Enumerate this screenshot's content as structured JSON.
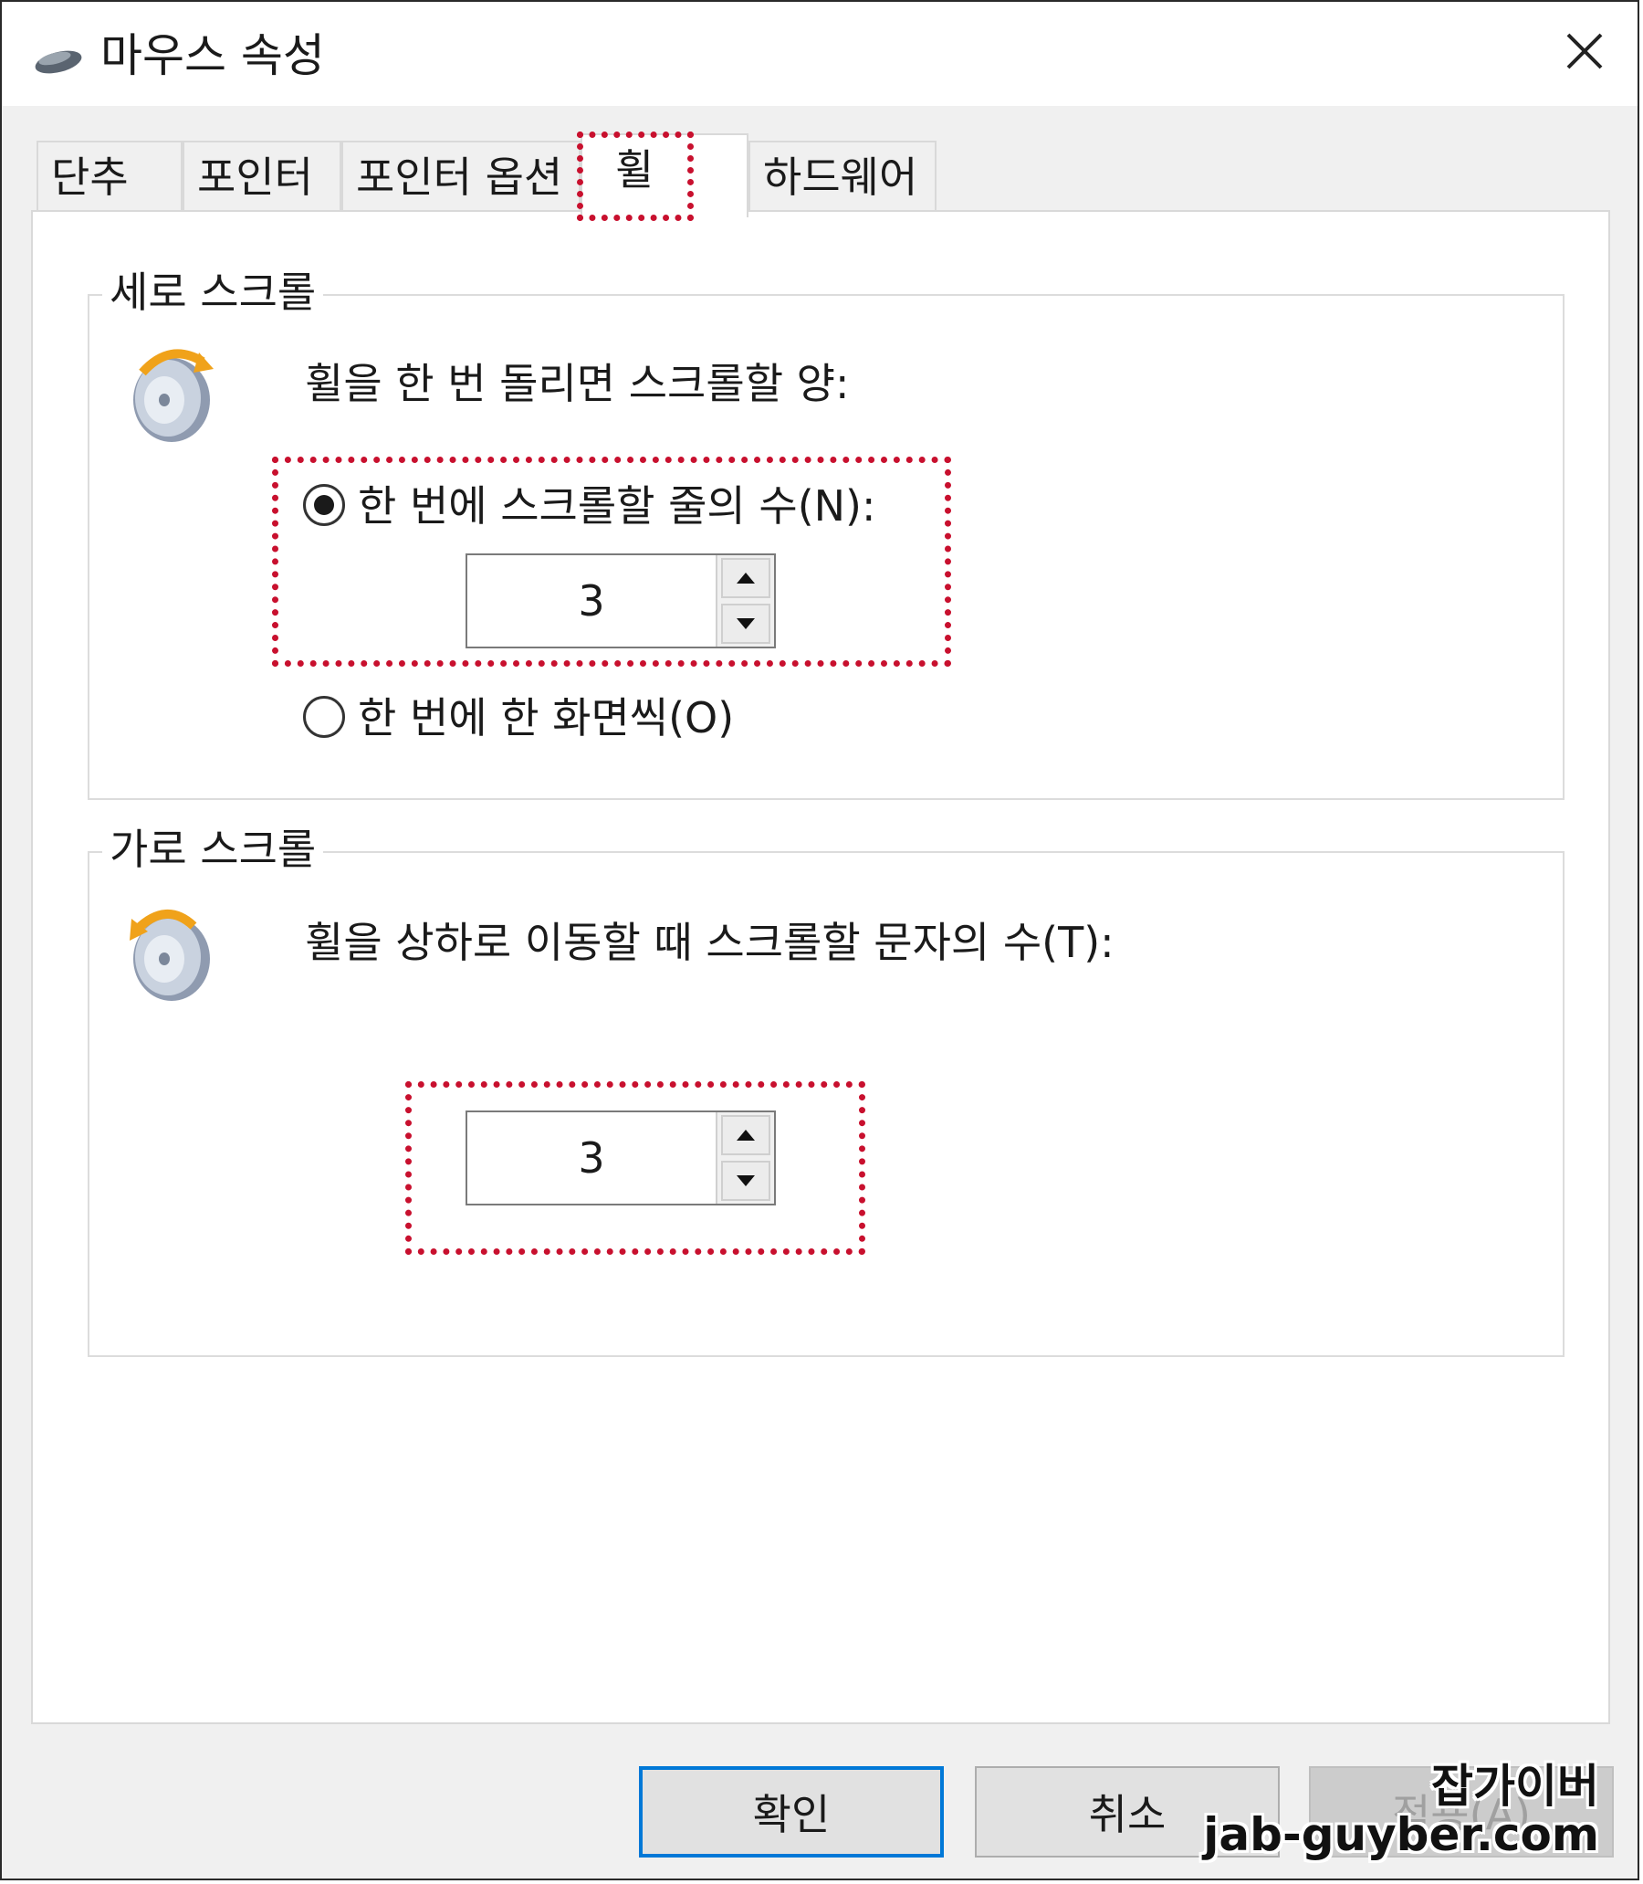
{
  "window": {
    "title": "마우스 속성",
    "icon": "mouse-icon",
    "close_icon": "close-icon"
  },
  "tabs": [
    {
      "label": "단추"
    },
    {
      "label": "포인터"
    },
    {
      "label": "포인터 옵션"
    },
    {
      "label": "휠",
      "active": true
    },
    {
      "label": "하드웨어"
    }
  ],
  "vertical_scroll": {
    "group_label": "세로 스크롤",
    "icon": "mouse-wheel-vertical-icon",
    "description": "휠을 한 번 돌리면 스크롤할 양:",
    "option_lines_label": "한 번에 스크롤할 줄의 수(N):",
    "option_lines_selected": true,
    "lines_value": "3",
    "option_screen_label": "한 번에 한 화면씩(O)",
    "option_screen_selected": false
  },
  "horizontal_scroll": {
    "group_label": "가로 스크롤",
    "icon": "mouse-wheel-horizontal-icon",
    "description": "휠을 상하로 이동할 때 스크롤할 문자의 수(T):",
    "chars_value": "3"
  },
  "buttons": {
    "ok": "확인",
    "cancel": "취소",
    "apply": "적용(A)"
  },
  "watermark": {
    "line1": "잡가이버",
    "line2": "jab-guyber.com"
  },
  "colors": {
    "highlight": "#c8102e",
    "accent": "#0078d7"
  }
}
